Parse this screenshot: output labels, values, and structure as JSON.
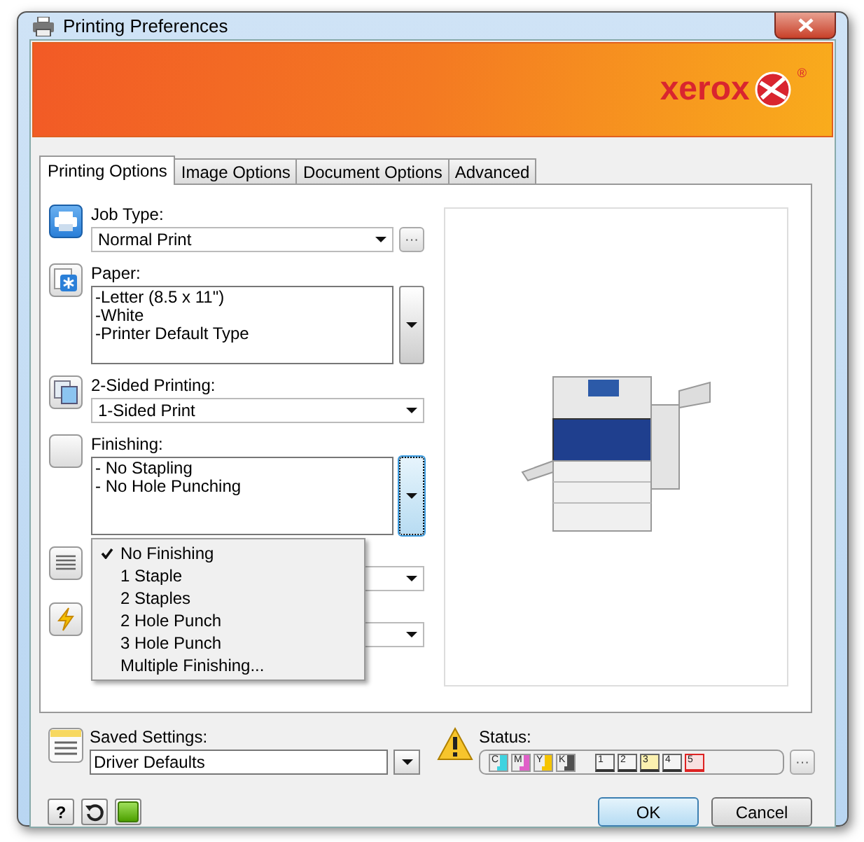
{
  "window": {
    "title": "Printing Preferences"
  },
  "banner": {
    "logo": "xerox",
    "mark": "®"
  },
  "tabs": [
    {
      "label": "Printing Options",
      "selected": true
    },
    {
      "label": "Image Options",
      "selected": false
    },
    {
      "label": "Document Options",
      "selected": false
    },
    {
      "label": "Advanced",
      "selected": false
    }
  ],
  "options": [
    {
      "kind": "combo",
      "label": "Job Type:",
      "value": "Normal Print",
      "more": "···"
    },
    {
      "kind": "list",
      "label": "Paper:",
      "lines": [
        "-Letter (8.5 x 11\")",
        "-White",
        "-Printer Default Type"
      ],
      "focused": false
    },
    {
      "kind": "combo",
      "label": "2-Sided Printing:",
      "value": "1-Sided Print"
    },
    {
      "kind": "list",
      "label": "Finishing:",
      "lines": [
        "- No Stapling",
        "- No Hole Punching"
      ],
      "focused": true
    },
    {
      "kind": "combo"
    },
    {
      "kind": "combo"
    }
  ],
  "finishing_menu": [
    {
      "label": "No Finishing",
      "selected": true
    },
    {
      "label": "1 Staple",
      "selected": false
    },
    {
      "label": "2 Staples",
      "selected": false
    },
    {
      "label": "2 Hole Punch",
      "selected": false
    },
    {
      "label": "3 Hole Punch",
      "selected": false
    },
    {
      "label": "Multiple Finishing...",
      "selected": false
    }
  ],
  "saved_settings": {
    "label": "Saved Settings:",
    "value": "Driver Defaults"
  },
  "status": {
    "label": "Status:",
    "more": "···",
    "supplies": [
      {
        "label": "C",
        "color": "#3fd3e0"
      },
      {
        "label": "M",
        "color": "#e060c8"
      },
      {
        "label": "Y",
        "color": "#f5c400"
      },
      {
        "label": "K",
        "color": "#505050"
      }
    ],
    "trays": [
      {
        "label": "1",
        "color": "#f4f4f4"
      },
      {
        "label": "2",
        "color": "#f4f4f4"
      },
      {
        "label": "3",
        "color": "#fbf1b0"
      },
      {
        "label": "4",
        "color": "#f4f4f4"
      },
      {
        "label": "5",
        "color": "#f8e0e0"
      }
    ]
  },
  "help_button": "?",
  "buttons": [
    {
      "label": "OK",
      "default": true
    },
    {
      "label": "Cancel",
      "default": false
    }
  ]
}
